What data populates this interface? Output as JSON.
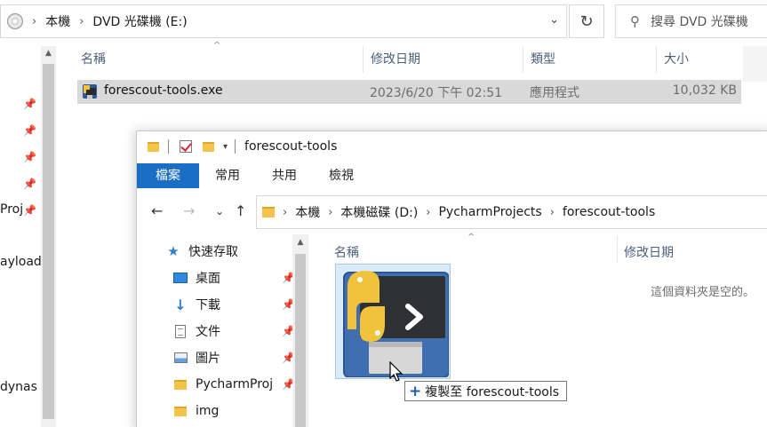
{
  "background_window": {
    "address": {
      "crumbs": [
        "本機",
        "DVD 光碟機 (E:)"
      ]
    },
    "search_placeholder": "搜尋 DVD 光碟機",
    "columns": {
      "name": "名稱",
      "date": "修改日期",
      "type": "類型",
      "size": "大小"
    },
    "file": {
      "name": "forescout-tools.exe",
      "date": "2023/6/20 下午 02:51",
      "type": "應用程式",
      "size": "10,032 KB"
    },
    "nav_fragments": [
      "Proj",
      "ayload",
      "dynas"
    ]
  },
  "foreground_window": {
    "title": "forescout-tools",
    "ribbon_tabs": [
      "檔案",
      "常用",
      "共用",
      "檢視"
    ],
    "address": {
      "crumbs": [
        "本機",
        "本機磁碟 (D:)",
        "PycharmProjects",
        "forescout-tools"
      ]
    },
    "nav": {
      "quick_access": "快速存取",
      "items": [
        "桌面",
        "下載",
        "文件",
        "圖片",
        "PycharmProj",
        "img"
      ]
    },
    "columns": {
      "name": "名稱",
      "date": "修改日期"
    },
    "empty_message": "這個資料夾是空的。"
  },
  "drag": {
    "tooltip_label": "複製至 forescout-tools"
  },
  "colors": {
    "accent": "#1a6ec4",
    "selection": "#d9d9d9",
    "drag_bg": "#cce2f5"
  }
}
